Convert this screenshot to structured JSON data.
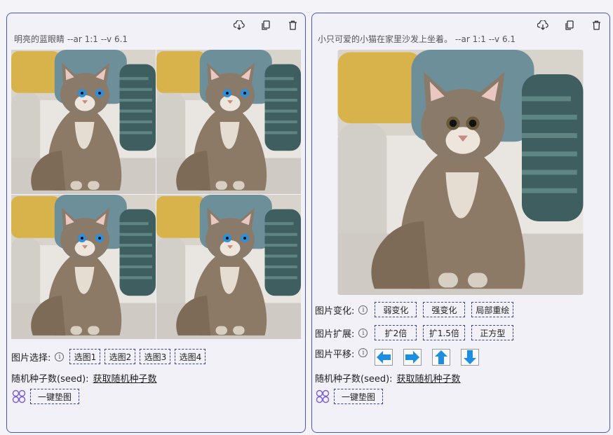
{
  "left": {
    "prompt": "明亮的蓝眼睛 --ar 1:1 --v 6.1",
    "select_label": "图片选择:",
    "select_buttons": [
      "选图1",
      "选图2",
      "选图3",
      "选图4"
    ],
    "seed_label": "随机种子数(seed):",
    "seed_link": "获取随机种子数",
    "pad_button": "一键垫图"
  },
  "right": {
    "prompt": "小只可爱的小猫在家里沙发上坐着。 --ar 1:1 --v 6.1",
    "vary_label": "图片变化:",
    "vary_buttons": [
      "弱变化",
      "强变化",
      "局部重绘"
    ],
    "expand_label": "图片扩展:",
    "expand_buttons": [
      "扩2倍",
      "扩1.5倍",
      "正方型"
    ],
    "pan_label": "图片平移:",
    "seed_label": "随机种子数(seed):",
    "seed_link": "获取随机种子数",
    "pad_button": "一键垫图"
  },
  "icons": {
    "toolbar": [
      "cloud-download-icon",
      "copy-icon",
      "trash-icon"
    ],
    "pan": [
      "arrow-left-icon",
      "arrow-right-icon",
      "arrow-up-icon",
      "arrow-down-icon"
    ],
    "pad": "clover-icon",
    "info": "info-icon"
  },
  "colors": {
    "panel_border": "#4a55c9",
    "arrow_blue": "#1e8fe0",
    "button_dash": "#3a3fa8",
    "clover": "#7a5cd6"
  }
}
